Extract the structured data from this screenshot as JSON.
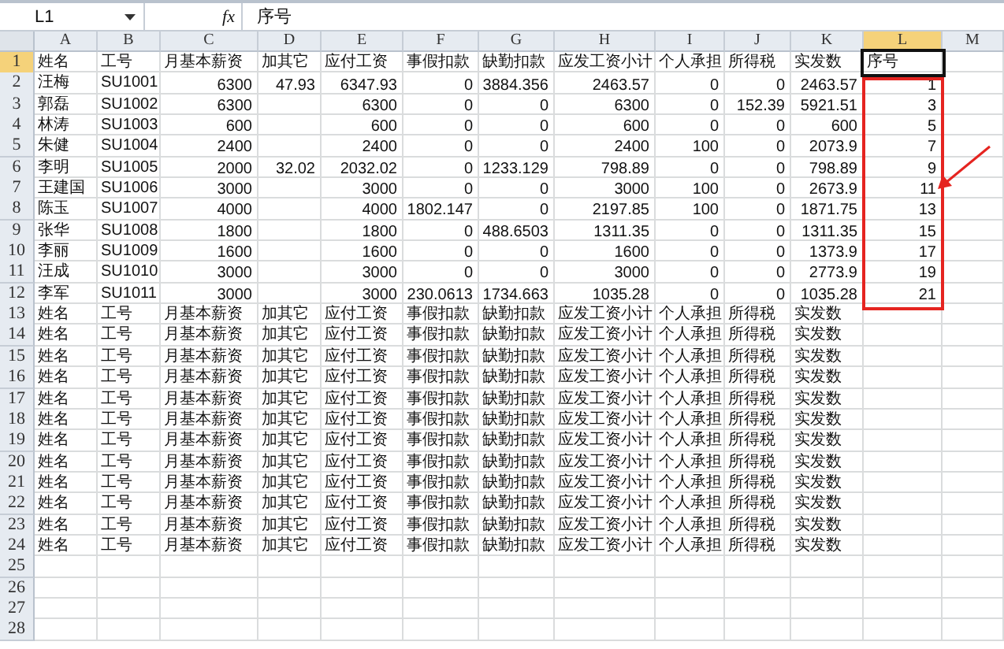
{
  "formula_bar": {
    "cell_reference": "L1",
    "function_label": "fx",
    "content": "序号"
  },
  "columns": [
    {
      "label": "A",
      "selected": false
    },
    {
      "label": "B",
      "selected": false
    },
    {
      "label": "C",
      "selected": false
    },
    {
      "label": "D",
      "selected": false
    },
    {
      "label": "E",
      "selected": false
    },
    {
      "label": "F",
      "selected": false
    },
    {
      "label": "G",
      "selected": false
    },
    {
      "label": "H",
      "selected": false
    },
    {
      "label": "I",
      "selected": false
    },
    {
      "label": "J",
      "selected": false
    },
    {
      "label": "K",
      "selected": false
    },
    {
      "label": "L",
      "selected": true
    },
    {
      "label": "M",
      "selected": false
    }
  ],
  "rows": [
    {
      "number": "1",
      "selected": true,
      "cells": [
        "姓名",
        "工号",
        "月基本薪资",
        "加其它",
        "应付工资",
        "事假扣款",
        "缺勤扣款",
        "应发工资小计",
        "个人承担",
        "所得税",
        "实发数",
        "序号"
      ]
    },
    {
      "number": "2",
      "selected": false,
      "cells": [
        "汪梅",
        "SU1001",
        "6300",
        "47.93",
        "6347.93",
        "0",
        "3884.356",
        "2463.57",
        "0",
        "0",
        "2463.57",
        "1"
      ]
    },
    {
      "number": "3",
      "selected": false,
      "cells": [
        "郭磊",
        "SU1002",
        "6300",
        null,
        "6300",
        "0",
        "0",
        "6300",
        "0",
        "152.39",
        "5921.51",
        "3"
      ]
    },
    {
      "number": "4",
      "selected": false,
      "cells": [
        "林涛",
        "SU1003",
        "600",
        null,
        "600",
        "0",
        "0",
        "600",
        "0",
        "0",
        "600",
        "5"
      ]
    },
    {
      "number": "5",
      "selected": false,
      "cells": [
        "朱健",
        "SU1004",
        "2400",
        null,
        "2400",
        "0",
        "0",
        "2400",
        "100",
        "0",
        "2073.9",
        "7"
      ]
    },
    {
      "number": "6",
      "selected": false,
      "cells": [
        "李明",
        "SU1005",
        "2000",
        "32.02",
        "2032.02",
        "0",
        "1233.129",
        "798.89",
        "0",
        "0",
        "798.89",
        "9"
      ]
    },
    {
      "number": "7",
      "selected": false,
      "cells": [
        "王建国",
        "SU1006",
        "3000",
        null,
        "3000",
        "0",
        "0",
        "3000",
        "100",
        "0",
        "2673.9",
        "11"
      ]
    },
    {
      "number": "8",
      "selected": false,
      "cells": [
        "陈玉",
        "SU1007",
        "4000",
        null,
        "4000",
        "1802.147",
        "0",
        "2197.85",
        "100",
        "0",
        "1871.75",
        "13"
      ]
    },
    {
      "number": "9",
      "selected": false,
      "cells": [
        "张华",
        "SU1008",
        "1800",
        null,
        "1800",
        "0",
        "488.6503",
        "1311.35",
        "0",
        "0",
        "1311.35",
        "15"
      ]
    },
    {
      "number": "10",
      "selected": false,
      "cells": [
        "李丽",
        "SU1009",
        "1600",
        null,
        "1600",
        "0",
        "0",
        "1600",
        "0",
        "0",
        "1373.9",
        "17"
      ]
    },
    {
      "number": "11",
      "selected": false,
      "cells": [
        "汪成",
        "SU1010",
        "3000",
        null,
        "3000",
        "0",
        "0",
        "3000",
        "0",
        "0",
        "2773.9",
        "19"
      ]
    },
    {
      "number": "12",
      "selected": false,
      "cells": [
        "李军",
        "SU1011",
        "3000",
        null,
        "3000",
        "230.0613",
        "1734.663",
        "1035.28",
        "0",
        "0",
        "1035.28",
        "21"
      ]
    },
    {
      "number": "13",
      "selected": false,
      "cells": [
        "姓名",
        "工号",
        "月基本薪资",
        "加其它",
        "应付工资",
        "事假扣款",
        "缺勤扣款",
        "应发工资小计",
        "个人承担",
        "所得税",
        "实发数"
      ]
    },
    {
      "number": "14",
      "selected": false,
      "cells": [
        "姓名",
        "工号",
        "月基本薪资",
        "加其它",
        "应付工资",
        "事假扣款",
        "缺勤扣款",
        "应发工资小计",
        "个人承担",
        "所得税",
        "实发数"
      ]
    },
    {
      "number": "15",
      "selected": false,
      "cells": [
        "姓名",
        "工号",
        "月基本薪资",
        "加其它",
        "应付工资",
        "事假扣款",
        "缺勤扣款",
        "应发工资小计",
        "个人承担",
        "所得税",
        "实发数"
      ]
    },
    {
      "number": "16",
      "selected": false,
      "cells": [
        "姓名",
        "工号",
        "月基本薪资",
        "加其它",
        "应付工资",
        "事假扣款",
        "缺勤扣款",
        "应发工资小计",
        "个人承担",
        "所得税",
        "实发数"
      ]
    },
    {
      "number": "17",
      "selected": false,
      "cells": [
        "姓名",
        "工号",
        "月基本薪资",
        "加其它",
        "应付工资",
        "事假扣款",
        "缺勤扣款",
        "应发工资小计",
        "个人承担",
        "所得税",
        "实发数"
      ]
    },
    {
      "number": "18",
      "selected": false,
      "cells": [
        "姓名",
        "工号",
        "月基本薪资",
        "加其它",
        "应付工资",
        "事假扣款",
        "缺勤扣款",
        "应发工资小计",
        "个人承担",
        "所得税",
        "实发数"
      ]
    },
    {
      "number": "19",
      "selected": false,
      "cells": [
        "姓名",
        "工号",
        "月基本薪资",
        "加其它",
        "应付工资",
        "事假扣款",
        "缺勤扣款",
        "应发工资小计",
        "个人承担",
        "所得税",
        "实发数"
      ]
    },
    {
      "number": "20",
      "selected": false,
      "cells": [
        "姓名",
        "工号",
        "月基本薪资",
        "加其它",
        "应付工资",
        "事假扣款",
        "缺勤扣款",
        "应发工资小计",
        "个人承担",
        "所得税",
        "实发数"
      ]
    },
    {
      "number": "21",
      "selected": false,
      "cells": [
        "姓名",
        "工号",
        "月基本薪资",
        "加其它",
        "应付工资",
        "事假扣款",
        "缺勤扣款",
        "应发工资小计",
        "个人承担",
        "所得税",
        "实发数"
      ]
    },
    {
      "number": "22",
      "selected": false,
      "cells": [
        "姓名",
        "工号",
        "月基本薪资",
        "加其它",
        "应付工资",
        "事假扣款",
        "缺勤扣款",
        "应发工资小计",
        "个人承担",
        "所得税",
        "实发数"
      ]
    },
    {
      "number": "23",
      "selected": false,
      "cells": [
        "姓名",
        "工号",
        "月基本薪资",
        "加其它",
        "应付工资",
        "事假扣款",
        "缺勤扣款",
        "应发工资小计",
        "个人承担",
        "所得税",
        "实发数"
      ]
    },
    {
      "number": "24",
      "selected": false,
      "cells": [
        "姓名",
        "工号",
        "月基本薪资",
        "加其它",
        "应付工资",
        "事假扣款",
        "缺勤扣款",
        "应发工资小计",
        "个人承担",
        "所得税",
        "实发数"
      ]
    },
    {
      "number": "25",
      "selected": false
    },
    {
      "number": "26",
      "selected": false
    },
    {
      "number": "27",
      "selected": false
    },
    {
      "number": "28",
      "selected": false
    }
  ]
}
